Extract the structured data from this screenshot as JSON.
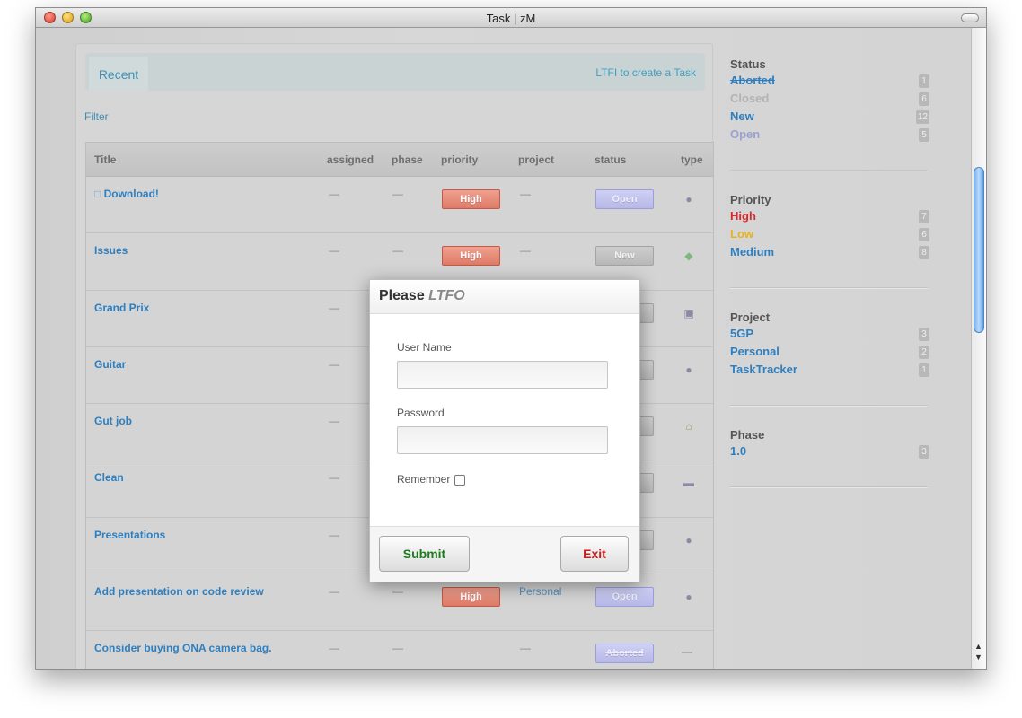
{
  "window": {
    "title": "Task | zM"
  },
  "tabs": {
    "recent": "Recent",
    "create_link": "LTFI to create a Task"
  },
  "filter": "Filter",
  "table": {
    "headers": [
      "Title",
      "assigned",
      "phase",
      "priority",
      "project",
      "status",
      "type"
    ],
    "rows": [
      {
        "title": "Download!",
        "assigned": "—",
        "phase": "—",
        "priority": "High",
        "project": "—",
        "status": "Open",
        "type_icon": "person-icon"
      },
      {
        "title": "Issues",
        "assigned": "—",
        "phase": "—",
        "priority": "High",
        "project": "—",
        "status": "New",
        "type_icon": "money-icon"
      },
      {
        "title": "Grand Prix",
        "assigned": "—",
        "type_icon": "camera-icon"
      },
      {
        "title": "Guitar",
        "assigned": "—",
        "type_icon": "person-icon"
      },
      {
        "title": "Gut job",
        "assigned": "—",
        "type_icon": "house-icon"
      },
      {
        "title": "Clean",
        "assigned": "—",
        "type_icon": "car-icon"
      },
      {
        "title": "Presentations",
        "assigned": "—",
        "type_icon": "person-icon"
      },
      {
        "title": "Add presentation on code review",
        "assigned": "—",
        "phase": "—",
        "priority": "High",
        "project": "Personal",
        "status": "Open",
        "type_icon": "person-icon"
      },
      {
        "title": "Consider buying ONA camera bag.",
        "assigned": "—",
        "phase": "—",
        "project": "—",
        "status": "Aborted",
        "type": "—"
      }
    ]
  },
  "sidebar": {
    "status": {
      "heading": "Status",
      "items": [
        {
          "label": "Aborted",
          "count": "1",
          "color": "#2f7fbf"
        },
        {
          "label": "Closed",
          "count": "6",
          "color": "#b3b3b3"
        },
        {
          "label": "New",
          "count": "12",
          "color": "#2f7fbf"
        },
        {
          "label": "Open",
          "count": "5",
          "color": "#9aa0d0"
        }
      ]
    },
    "priority": {
      "heading": "Priority",
      "items": [
        {
          "label": "High",
          "count": "7",
          "color": "#d9282b"
        },
        {
          "label": "Low",
          "count": "6",
          "color": "#e3b322"
        },
        {
          "label": "Medium",
          "count": "8",
          "color": "#2f7fbf"
        }
      ]
    },
    "project": {
      "heading": "Project",
      "items": [
        {
          "label": "5GP",
          "count": "3",
          "color": "#2f7fbf"
        },
        {
          "label": "Personal",
          "count": "2",
          "color": "#2f7fbf"
        },
        {
          "label": "TaskTracker",
          "count": "1",
          "color": "#2f7fbf"
        }
      ]
    },
    "phase": {
      "heading": "Phase",
      "items": [
        {
          "label": "1.0",
          "count": "3",
          "color": "#2f7fbf"
        }
      ]
    }
  },
  "modal": {
    "title_prefix": "Please",
    "title_emph": "LTFO",
    "username_label": "User Name",
    "username_value": "",
    "password_label": "Password",
    "password_value": "",
    "remember_label": "Remember",
    "submit_label": "Submit",
    "exit_label": "Exit"
  }
}
